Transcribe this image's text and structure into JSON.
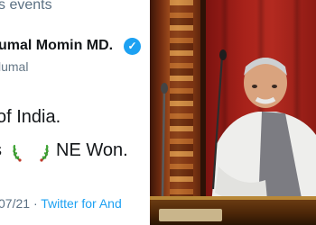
{
  "tweet": {
    "context": "s events",
    "display_name": "umal Momin MD.",
    "verified_glyph": "✓",
    "handle": "lumal",
    "text_line1": "of India.",
    "text_line2_prefix": "s",
    "text_line2_suffix": "NE Won.",
    "emoji": [
      "laurel-wreath-left",
      "laurel-wreath-right"
    ],
    "date": "07/21",
    "separator": "·",
    "source": "Twitter for And"
  },
  "colors": {
    "link_blue": "#1da1f2",
    "text_dark": "#14171a",
    "text_muted": "#5b7083",
    "curtain_red": "#a8221a",
    "wood_brown": "#6e2a0f"
  }
}
